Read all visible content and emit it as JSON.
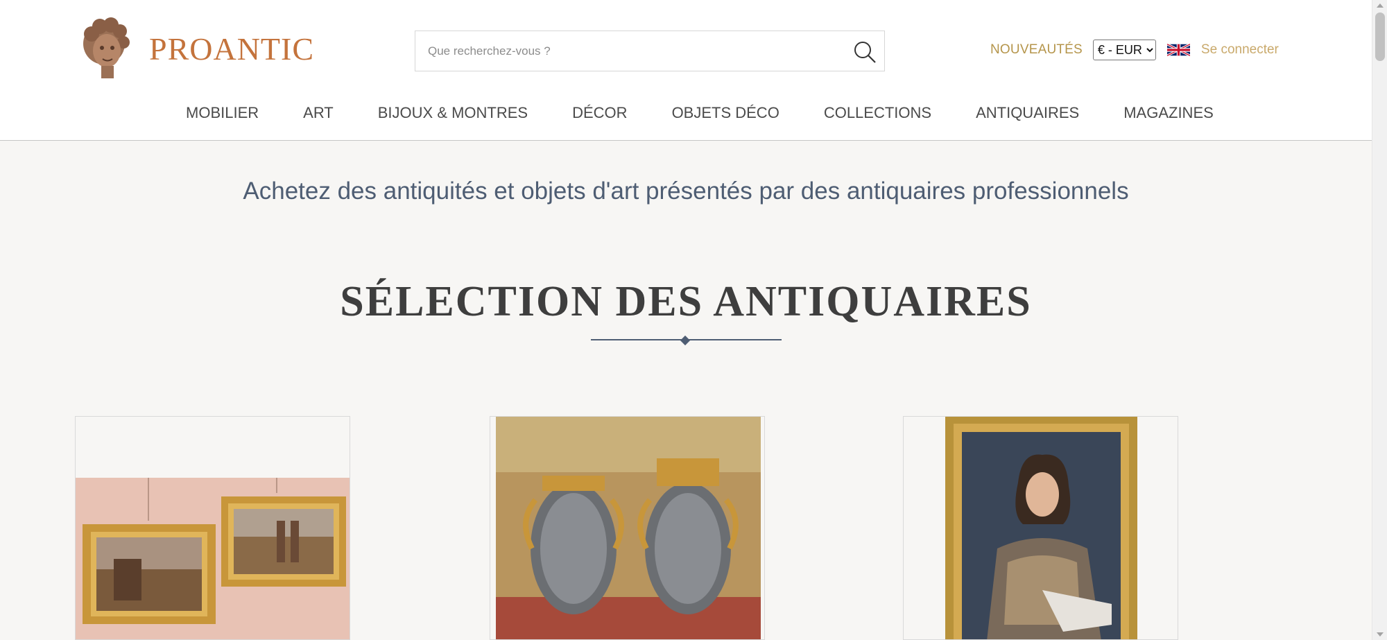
{
  "header": {
    "logo_text": "PROANTIC",
    "logo_icon": "cherub-head-icon",
    "search": {
      "placeholder": "Que recherchez-vous ?",
      "value": ""
    },
    "nouveautes": "NOUVEAUTÉS",
    "currency": {
      "selected": "€ - EUR"
    },
    "language_icon": "uk-flag-icon",
    "login_label": "Se connecter"
  },
  "nav": {
    "items": [
      {
        "label": "MOBILIER"
      },
      {
        "label": "ART"
      },
      {
        "label": "BIJOUX & MONTRES"
      },
      {
        "label": "DÉCOR"
      },
      {
        "label": "OBJETS DÉCO"
      },
      {
        "label": "COLLECTIONS"
      },
      {
        "label": "ANTIQUAIRES"
      },
      {
        "label": "MAGAZINES"
      }
    ]
  },
  "tagline": "Achetez des antiquités et objets d'art présentés par des antiquaires professionnels",
  "section": {
    "title": "SÉLECTION DES ANTIQUAIRES"
  },
  "cards": [
    {
      "image": "pair-of-framed-landscape-paintings"
    },
    {
      "image": "pair-of-gilt-bronze-mounted-marble-vases"
    },
    {
      "image": "portrait-of-young-nobleman-in-armour"
    }
  ],
  "colors": {
    "logo": "#c4733c",
    "nav_text": "#4a4a4a",
    "tagline": "#4e5d73",
    "gold": "#b5954b",
    "login": "#c9a96b",
    "page_bg": "#f7f6f4"
  }
}
